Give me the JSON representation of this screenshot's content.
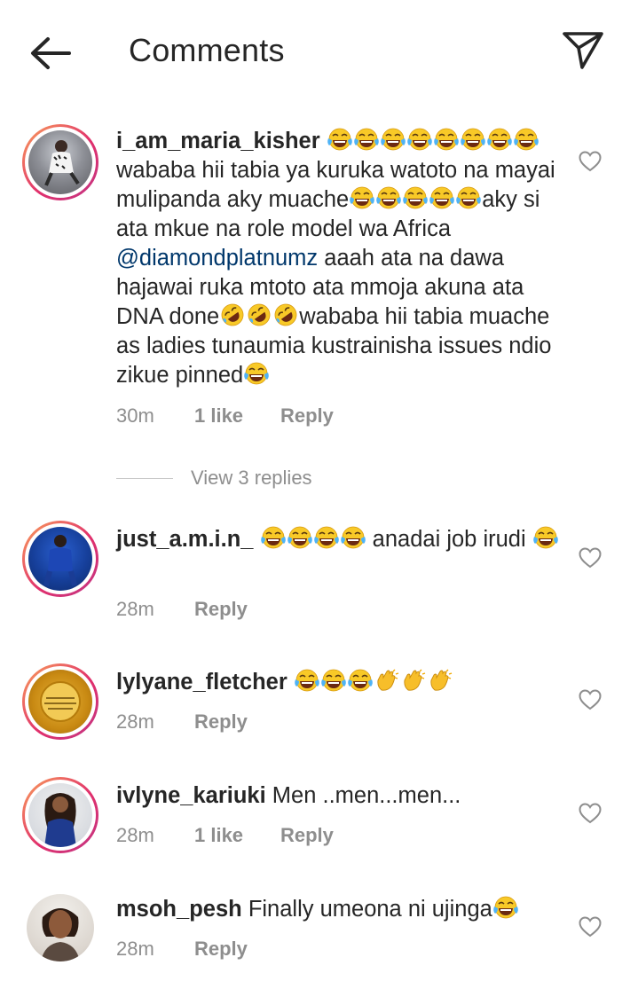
{
  "header": {
    "title": "Comments",
    "back_icon": "arrow-left-icon",
    "share_icon": "paper-plane-icon"
  },
  "colors": {
    "text": "#262626",
    "muted": "#8e8e8e",
    "mention": "#00376b",
    "story_ring": [
      "#f9a15a",
      "#e1306c",
      "#c13584"
    ]
  },
  "comments": [
    {
      "username": "i_am_maria_kisher",
      "text_1": "wababa hii tabia ya kuruka watoto na mayai mulipanda aky muache",
      "text_2": "aky si ata mkue na role model wa Africa",
      "mention": "@diamondplatnumz",
      "text_3": "aaah ata na dawa hajawai ruka mtoto ata mmoja akuna ata DNA done",
      "text_4": "wababa hii tabia muache as ladies tunaumia kustrainisha issues ndio zikue pinned",
      "time": "30m",
      "likes": "1 like",
      "reply": "Reply",
      "view_replies": "View 3 replies"
    },
    {
      "username": "just_a.m.i.n_",
      "text_1": "anadai job irudi",
      "time": "28m",
      "reply": "Reply"
    },
    {
      "username": "lylyane_fletcher",
      "time": "28m",
      "reply": "Reply"
    },
    {
      "username": "ivlyne_kariuki",
      "text_1": "Men ..men...men...",
      "time": "28m",
      "likes": "1 like",
      "reply": "Reply"
    },
    {
      "username": "msoh_pesh",
      "text_1": "Finally umeona ni ujinga",
      "time": "28m",
      "reply": "Reply"
    }
  ]
}
